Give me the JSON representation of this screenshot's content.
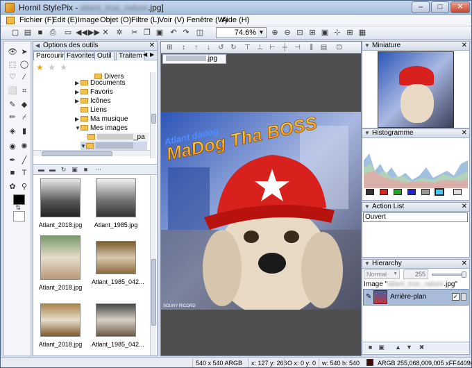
{
  "window": {
    "title_prefix": "Hornil StylePix - ",
    "title_file": "atlant_true_nature",
    "title_ext": ".jpg]",
    "min": "–",
    "max": "□",
    "close": "✕"
  },
  "menu": [
    "Fichier (F)",
    "Edit (E)",
    "Image",
    "Objet (O)",
    "Filtre (L)",
    "Voir (V)",
    "Fenêtre (W)",
    "Aide (H)"
  ],
  "toolbar": {
    "zoom": "74.6%"
  },
  "options_panel": {
    "title": "Options des outils",
    "tabs": [
      "Parcourir",
      "Favorites",
      "Outil",
      "Traitem"
    ],
    "tree": [
      {
        "label": "Divers"
      },
      {
        "label": "Documents"
      },
      {
        "label": "Favoris"
      },
      {
        "label": "Icônes"
      },
      {
        "label": "Liens"
      },
      {
        "label": "Ma musique"
      },
      {
        "label": "Mes images"
      },
      {
        "label": "_pa"
      }
    ],
    "thumbnails": [
      {
        "caption": "Atlant_2018.jpg"
      },
      {
        "caption": "Atlant_1985.jpg"
      },
      {
        "caption": "Atlant_2018.jpg"
      },
      {
        "caption": "Atlant_1985_042..."
      },
      {
        "caption": "Atlant_2018.jpg"
      },
      {
        "caption": "Atlant_1985_042..."
      }
    ]
  },
  "document": {
    "tab_file": "atlant_true_nature.jpg",
    "tab_suffix": ".jpg",
    "image_text_small": "Atlant dadog",
    "image_text_big": "MaDog Tha BOSS",
    "credit": "SOUNY RICORD"
  },
  "panels": {
    "miniature": {
      "title": "Miniature"
    },
    "histogram": {
      "title": "Histogramme"
    },
    "action_list": {
      "title": "Action List",
      "items": [
        "Ouvert"
      ]
    },
    "hierarchy": {
      "title": "Hierarchy",
      "mode": "Normal",
      "opacity": "255",
      "image_label_prefix": "Image \"",
      "image_label_file": "atlant_true_nature",
      "image_label_suffix": ".jpg\"",
      "layer_name": "Arrière-plan"
    }
  },
  "status": {
    "size": "540 x 540 ARGB",
    "coords": "x: 127 y: 266",
    "offset": "O x:  0 y:  0",
    "dims": "w: 540 h: 540",
    "color": "ARGB 255,068,009,005 xFF440905",
    "color_hex": "#440905"
  }
}
